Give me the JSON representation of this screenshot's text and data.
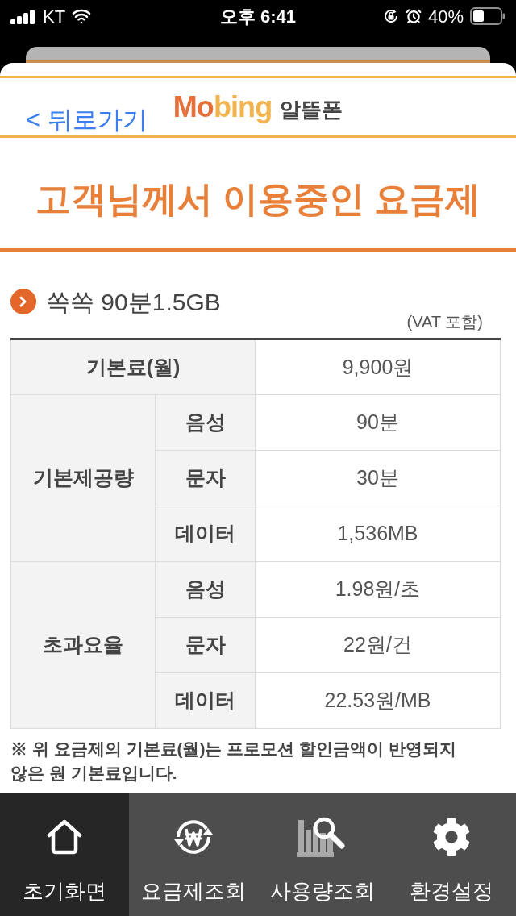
{
  "status_bar": {
    "carrier": "KT",
    "time": "오후 6:41",
    "battery": "40%"
  },
  "header": {
    "back_link": "< 뒤로가기",
    "logo": {
      "brand": "Mobing",
      "suffix": "알뜰폰"
    }
  },
  "page_title": "고객님께서 이용중인 요금제",
  "plan": {
    "name": "쏙쏙 90분1.5GB",
    "vat_note": "(VAT 포함)"
  },
  "table": {
    "rows": [
      {
        "kind": "single",
        "label": "기본료(월)",
        "value": "9,900원"
      },
      {
        "kind": "group",
        "label": "기본제공량",
        "items": [
          {
            "label": "음성",
            "value": "90분"
          },
          {
            "label": "문자",
            "value": "30분"
          },
          {
            "label": "데이터",
            "value": "1,536MB"
          }
        ]
      },
      {
        "kind": "group",
        "label": "초과요율",
        "items": [
          {
            "label": "음성",
            "value": "1.98원/초"
          },
          {
            "label": "문자",
            "value": "22원/건"
          },
          {
            "label": "데이터",
            "value": "22.53원/MB"
          }
        ]
      }
    ]
  },
  "note": "※ 위 요금제의 기본료(월)는 프로모션 할인금액이 반영되지 않은 원 기본료입니다.",
  "tab_bar": [
    {
      "label": "초기화면",
      "selected": true
    },
    {
      "label": "요금제조회",
      "selected": false
    },
    {
      "label": "사용량조회",
      "selected": false
    },
    {
      "label": "환경설정",
      "selected": false
    }
  ]
}
